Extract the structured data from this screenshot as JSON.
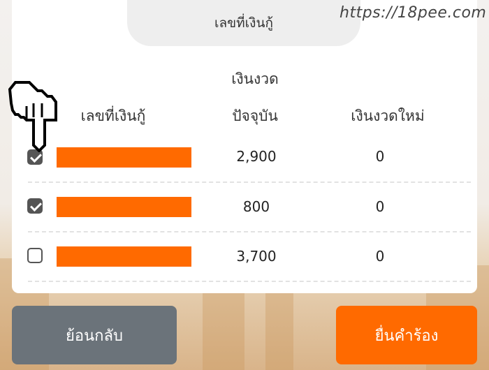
{
  "header": {
    "title": "เลขที่เงินกู้"
  },
  "watermark": "https://18pee.com",
  "table": {
    "columns": {
      "loan_no": "เลขที่เงินกู้",
      "current_installment_line1": "เงินงวด",
      "current_installment_line2": "ปัจจุบัน",
      "new_installment": "เงินงวดใหม่"
    },
    "rows": [
      {
        "checked": true,
        "current": "2,900",
        "new": "0"
      },
      {
        "checked": true,
        "current": "800",
        "new": "0"
      },
      {
        "checked": false,
        "current": "3,700",
        "new": "0"
      }
    ]
  },
  "buttons": {
    "back": "ย้อนกลับ",
    "submit": "ยื่นคำร้อง"
  },
  "colors": {
    "accent": "#ff6a00",
    "back_button": "#6b737a",
    "redaction": "#ff6a00"
  },
  "icons": {
    "pointer": "hand-pointer-icon"
  }
}
